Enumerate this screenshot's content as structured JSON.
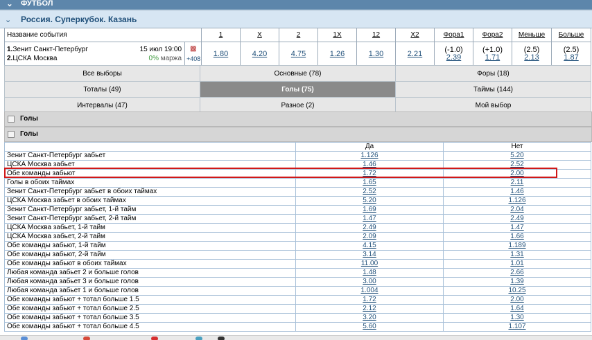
{
  "sport_bar": {
    "chevron": "chevron-down-icon",
    "title": "ФУТБОЛ"
  },
  "league_bar": {
    "chevron": "chevron-down-icon",
    "title": "Россия. Суперкубок. Казань"
  },
  "header": {
    "event_name_label": "Название события",
    "columns": [
      "1",
      "X",
      "2",
      "1X",
      "12",
      "X2",
      "Фора1",
      "Фора2",
      "Меньше",
      "Больше"
    ]
  },
  "event": {
    "team1_num": "1.",
    "team1": "Зенит Санкт-Петербург",
    "team2_num": "2.",
    "team2": "ЦСКА Москва",
    "date": "15 июл 19:00",
    "margin_pct": "0%",
    "margin_label": "маржа",
    "stats_icon": "bar-chart-icon",
    "more_markets": "+408",
    "odds": {
      "o1": "1.80",
      "x": "4.20",
      "o2": "4.75",
      "o1x": "1.26",
      "o12": "1.30",
      "x2": "2.21",
      "fora1_line": "(-1.0)",
      "fora1_odds": "2.39",
      "fora2_line": "(+1.0)",
      "fora2_odds": "1.71",
      "under_line": "(2.5)",
      "under_odds": "2.13",
      "over_line": "(2.5)",
      "over_odds": "1.87"
    }
  },
  "tabs": {
    "row1": [
      "Все выборы",
      "Основные (78)",
      "Форы (18)"
    ],
    "row2": [
      "Тоталы (49)",
      "Голы (75)",
      "Таймы (144)"
    ],
    "row3": [
      "Интервалы (47)",
      "Разное (2)",
      "Мой выбор"
    ],
    "active": "Голы (75)"
  },
  "sections": [
    "Голы",
    "Голы"
  ],
  "market": {
    "col_yes": "Да",
    "col_no": "Нет",
    "rows": [
      {
        "label": "Зенит Санкт-Петербург забьет",
        "yes": "1.126",
        "no": "5.20"
      },
      {
        "label": "ЦСКА Москва забьет",
        "yes": "1.46",
        "no": "2.52"
      },
      {
        "label": "Обе команды забьют",
        "yes": "1.72",
        "no": "2.00"
      },
      {
        "label": "Голы в обоих таймах",
        "yes": "1.65",
        "no": "2.11"
      },
      {
        "label": "Зенит Санкт-Петербург забьет в обоих таймах",
        "yes": "2.52",
        "no": "1.46"
      },
      {
        "label": "ЦСКА Москва забьет в обоих таймах",
        "yes": "5.20",
        "no": "1.126"
      },
      {
        "label": "Зенит Санкт-Петербург забьет, 1-й тайм",
        "yes": "1.69",
        "no": "2.04"
      },
      {
        "label": "Зенит Санкт-Петербург забьет, 2-й тайм",
        "yes": "1.47",
        "no": "2.49"
      },
      {
        "label": "ЦСКА Москва забьет, 1-й тайм",
        "yes": "2.49",
        "no": "1.47"
      },
      {
        "label": "ЦСКА Москва забьет, 2-й тайм",
        "yes": "2.09",
        "no": "1.66"
      },
      {
        "label": "Обе команды забьют, 1-й тайм",
        "yes": "4.15",
        "no": "1.189"
      },
      {
        "label": "Обе команды забьют, 2-й тайм",
        "yes": "3.14",
        "no": "1.31"
      },
      {
        "label": "Обе команды забьют в обоих таймах",
        "yes": "11.00",
        "no": "1.01"
      },
      {
        "label": "Любая команда забьет 2 и больше голов",
        "yes": "1.48",
        "no": "2.66"
      },
      {
        "label": "Любая команда забьет 3 и больше голов",
        "yes": "3.00",
        "no": "1.39"
      },
      {
        "label": "Любая команда забьет 1 и больше голов",
        "yes": "1.004",
        "no": "10.25"
      },
      {
        "label": "Обе команды забьют + тотал больше 1.5",
        "yes": "1.72",
        "no": "2.00"
      },
      {
        "label": "Обе команды забьют + тотал больше 2.5",
        "yes": "2.12",
        "no": "1.64"
      },
      {
        "label": "Обе команды забьют + тотал больше 3.5",
        "yes": "3.20",
        "no": "1.30"
      },
      {
        "label": "Обе команды забьют + тотал больше 4.5",
        "yes": "5.60",
        "no": "1.107"
      }
    ],
    "highlighted_row": "Обе команды забьют"
  },
  "colors": {
    "sport_bar": "#5d86ab",
    "league_bar": "#d7e6f3",
    "link": "#1f4f79",
    "active_tab": "#8a8a8a",
    "highlight": "#d01818"
  }
}
